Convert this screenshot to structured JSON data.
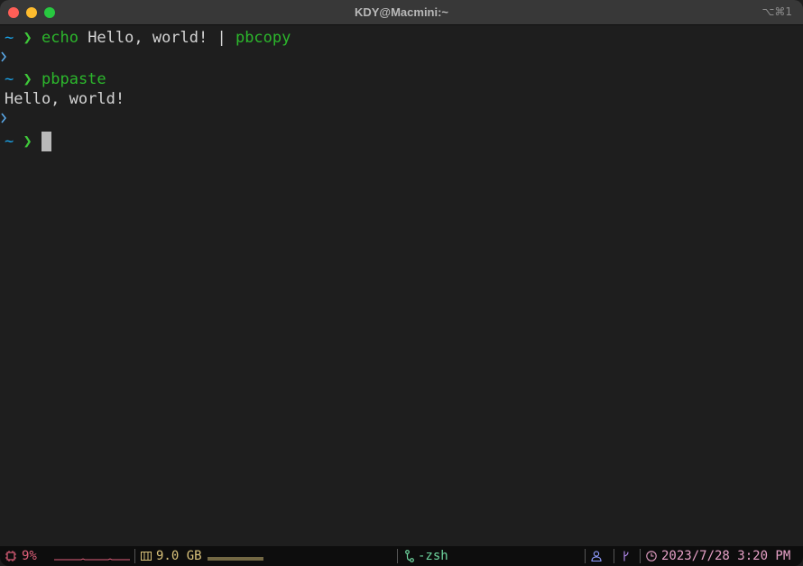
{
  "window": {
    "title": "KDY@Macmini:~",
    "shortcut": "⌥⌘1"
  },
  "terminal": {
    "prompt": {
      "dir": "~",
      "arrow": "❯"
    },
    "lines": [
      {
        "cmd": "echo",
        "args": " Hello, world! | ",
        "cmd2": "pbcopy"
      },
      {
        "cmd": "pbpaste"
      },
      {
        "output": "Hello, world!"
      }
    ]
  },
  "statusbar": {
    "cpu": "9%",
    "memory": "9.0 GB",
    "session": "-zsh",
    "datetime": "2023/7/28 3:20 PM"
  },
  "colors": {
    "cpu": "#e0607a",
    "memory": "#d9c27a",
    "session": "#6fd7a0",
    "user": "#8f9cff",
    "branch": "#b68cf0",
    "datetime": "#e6a0c6"
  }
}
